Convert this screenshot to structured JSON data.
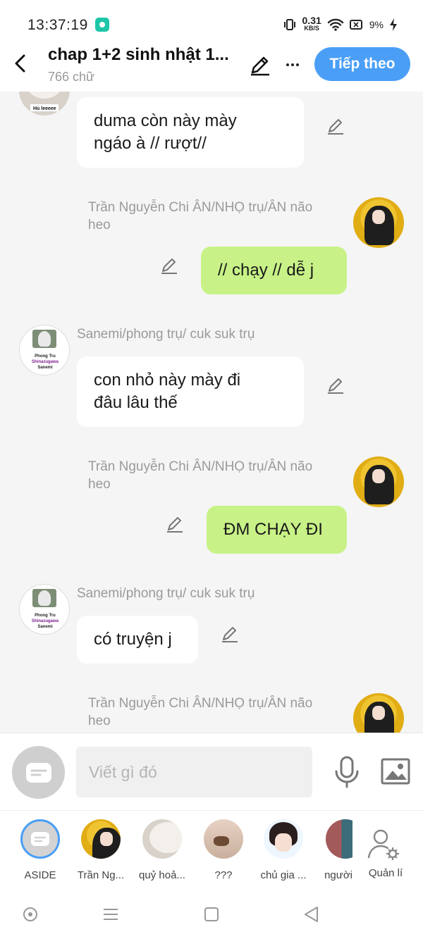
{
  "status": {
    "time": "13:37:19",
    "net_speed": "0.31",
    "net_unit": "KB/S",
    "battery": "9%"
  },
  "header": {
    "title": "chap 1+2 sinh nhật 1...",
    "subtitle": "766 chữ",
    "next_label": "Tiếp theo"
  },
  "messages": [
    {
      "sender": "",
      "text_lines": [
        "duma còn này mày",
        "ngáo à // rượt//"
      ],
      "side": "left"
    },
    {
      "sender_lines": [
        "Trần Nguyễn Chi ÂN/NHỌ trụ/ÂN não",
        "heo"
      ],
      "text": "// chạy // dễ j",
      "side": "right"
    },
    {
      "sender": "Sanemi/phong trụ/ cuk suk trụ",
      "text_lines": [
        "con nhỏ này mày đi",
        "đâu lâu thế"
      ],
      "side": "left"
    },
    {
      "sender_lines": [
        "Trần Nguyễn Chi ÂN/NHỌ trụ/ÂN não",
        "heo"
      ],
      "text": "ĐM CHẠY ĐI",
      "side": "right"
    },
    {
      "sender": "Sanemi/phong trụ/ cuk suk trụ",
      "text": "có truyện j",
      "side": "left"
    },
    {
      "sender_lines": [
        "Trần Nguyễn Chi ÂN/NHỌ trụ/ÂN não",
        "heo"
      ],
      "side": "right"
    }
  ],
  "avatar_captions": {
    "top_cat": "Hủ leeeee",
    "phong_1": "Phong Tru",
    "phong_2": "Shinazugawa",
    "phong_3": "Sanemi"
  },
  "composer": {
    "placeholder": "Viết gì đó"
  },
  "characters": [
    {
      "name": "ASIDE"
    },
    {
      "name": "Trần Ng..."
    },
    {
      "name": "quỷ hoả..."
    },
    {
      "name": "???"
    },
    {
      "name": "chủ gia ..."
    },
    {
      "name": "người"
    }
  ],
  "manage_label": "Quản lí",
  "colors": {
    "accent": "#4a9ef6",
    "bubble_right": "#c8f287",
    "bubble_left": "#ffffff"
  }
}
